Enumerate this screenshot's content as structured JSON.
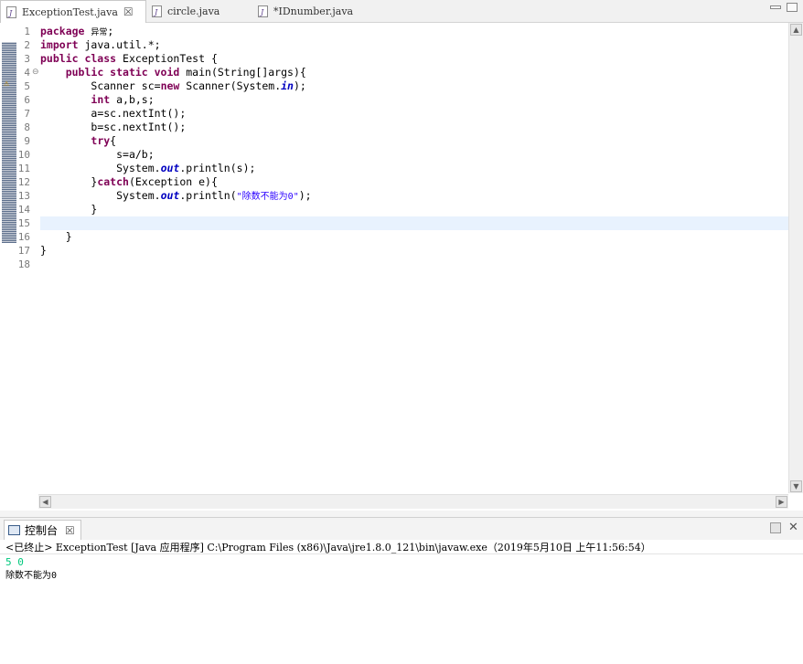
{
  "editor_tabs": [
    {
      "label": "ExceptionTest.java",
      "active": true,
      "close": "☒"
    },
    {
      "label": "circle.java",
      "active": false
    },
    {
      "label": "*IDnumber.java",
      "active": false
    }
  ],
  "code_lines": [
    {
      "n": "1"
    },
    {
      "n": "2"
    },
    {
      "n": "3"
    },
    {
      "n": "4"
    },
    {
      "n": "5"
    },
    {
      "n": "6"
    },
    {
      "n": "7"
    },
    {
      "n": "8"
    },
    {
      "n": "9"
    },
    {
      "n": "10"
    },
    {
      "n": "11"
    },
    {
      "n": "12"
    },
    {
      "n": "13"
    },
    {
      "n": "14"
    },
    {
      "n": "15"
    },
    {
      "n": "16"
    },
    {
      "n": "17"
    },
    {
      "n": "18"
    }
  ],
  "code": {
    "l1_kw": "package",
    "l1_pkg": "异常",
    "l1_end": ";",
    "l2_kw": "import",
    "l2_rest": " java.util.*;",
    "l3_kw": "public class",
    "l3_rest": " ExceptionTest {",
    "l4_kw": "public static void",
    "l4_rest": " main(String[]args){",
    "l5_a": "Scanner sc=",
    "l5_kw": "new",
    "l5_b": " Scanner(System.",
    "l5_fld": "in",
    "l5_c": ");",
    "l6_kw": "int",
    "l6_rest": " a,b,s;",
    "l7": "a=sc.nextInt();",
    "l8": "b=sc.nextInt();",
    "l9_kw": "try",
    "l9_rest": "{",
    "l10": "s=a/b;",
    "l11_a": "System.",
    "l11_fld": "out",
    "l11_b": ".println(s);",
    "l12_a": "}",
    "l12_kw": "catch",
    "l12_b": "(Exception e){",
    "l13_a": "System.",
    "l13_fld": "out",
    "l13_b": ".println(",
    "l13_str": "\"除数不能为0\"",
    "l13_c": ");",
    "l14": "}",
    "l16": "}",
    "l17": "}"
  },
  "console": {
    "tab_label": "控制台",
    "close": "☒",
    "terminated": "<已终止> ExceptionTest [Java 应用程序] C:\\Program Files (x86)\\Java\\jre1.8.0_121\\bin\\javaw.exe（2019年5月10日 上午11:56:54）",
    "input_line": "5 0",
    "output_line": "除数不能为0"
  },
  "colors": {
    "keyword": "#7f0055",
    "field": "#0000c0",
    "string": "#2a00ff",
    "input": "#00c87d",
    "current_line": "#e8f2fe"
  }
}
